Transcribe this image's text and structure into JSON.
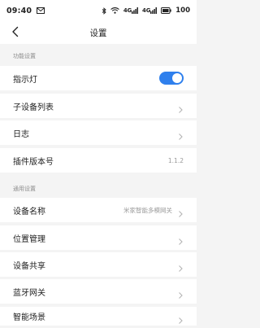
{
  "status_bar": {
    "time": "09:40",
    "signal_1": "4G",
    "signal_2": "4G",
    "battery": "100",
    "icons": [
      "mail-icon",
      "bluetooth-icon",
      "wifi-icon",
      "signal-icon",
      "battery-icon"
    ]
  },
  "header": {
    "title": "设置",
    "back_icon": "back-arrow-icon"
  },
  "sections": [
    {
      "header": "功能设置",
      "rows": [
        {
          "label": "指示灯",
          "type": "toggle",
          "state": "on"
        },
        {
          "label": "子设备列表",
          "type": "link"
        },
        {
          "label": "日志",
          "type": "link"
        },
        {
          "label": "插件版本号",
          "type": "value",
          "value": "1.1.2"
        }
      ]
    },
    {
      "header": "通用设置",
      "rows": [
        {
          "label": "设备名称",
          "type": "link",
          "value": "米家智能多模网关"
        },
        {
          "label": "位置管理",
          "type": "link"
        },
        {
          "label": "设备共享",
          "type": "link"
        },
        {
          "label": "蓝牙网关",
          "type": "link"
        },
        {
          "label": "智能场景",
          "type": "link"
        }
      ]
    }
  ],
  "colors": {
    "accent": "#2f80ed",
    "background": "#f4f4f4",
    "row": "#ffffff",
    "muted_text": "#8c8c8c"
  }
}
